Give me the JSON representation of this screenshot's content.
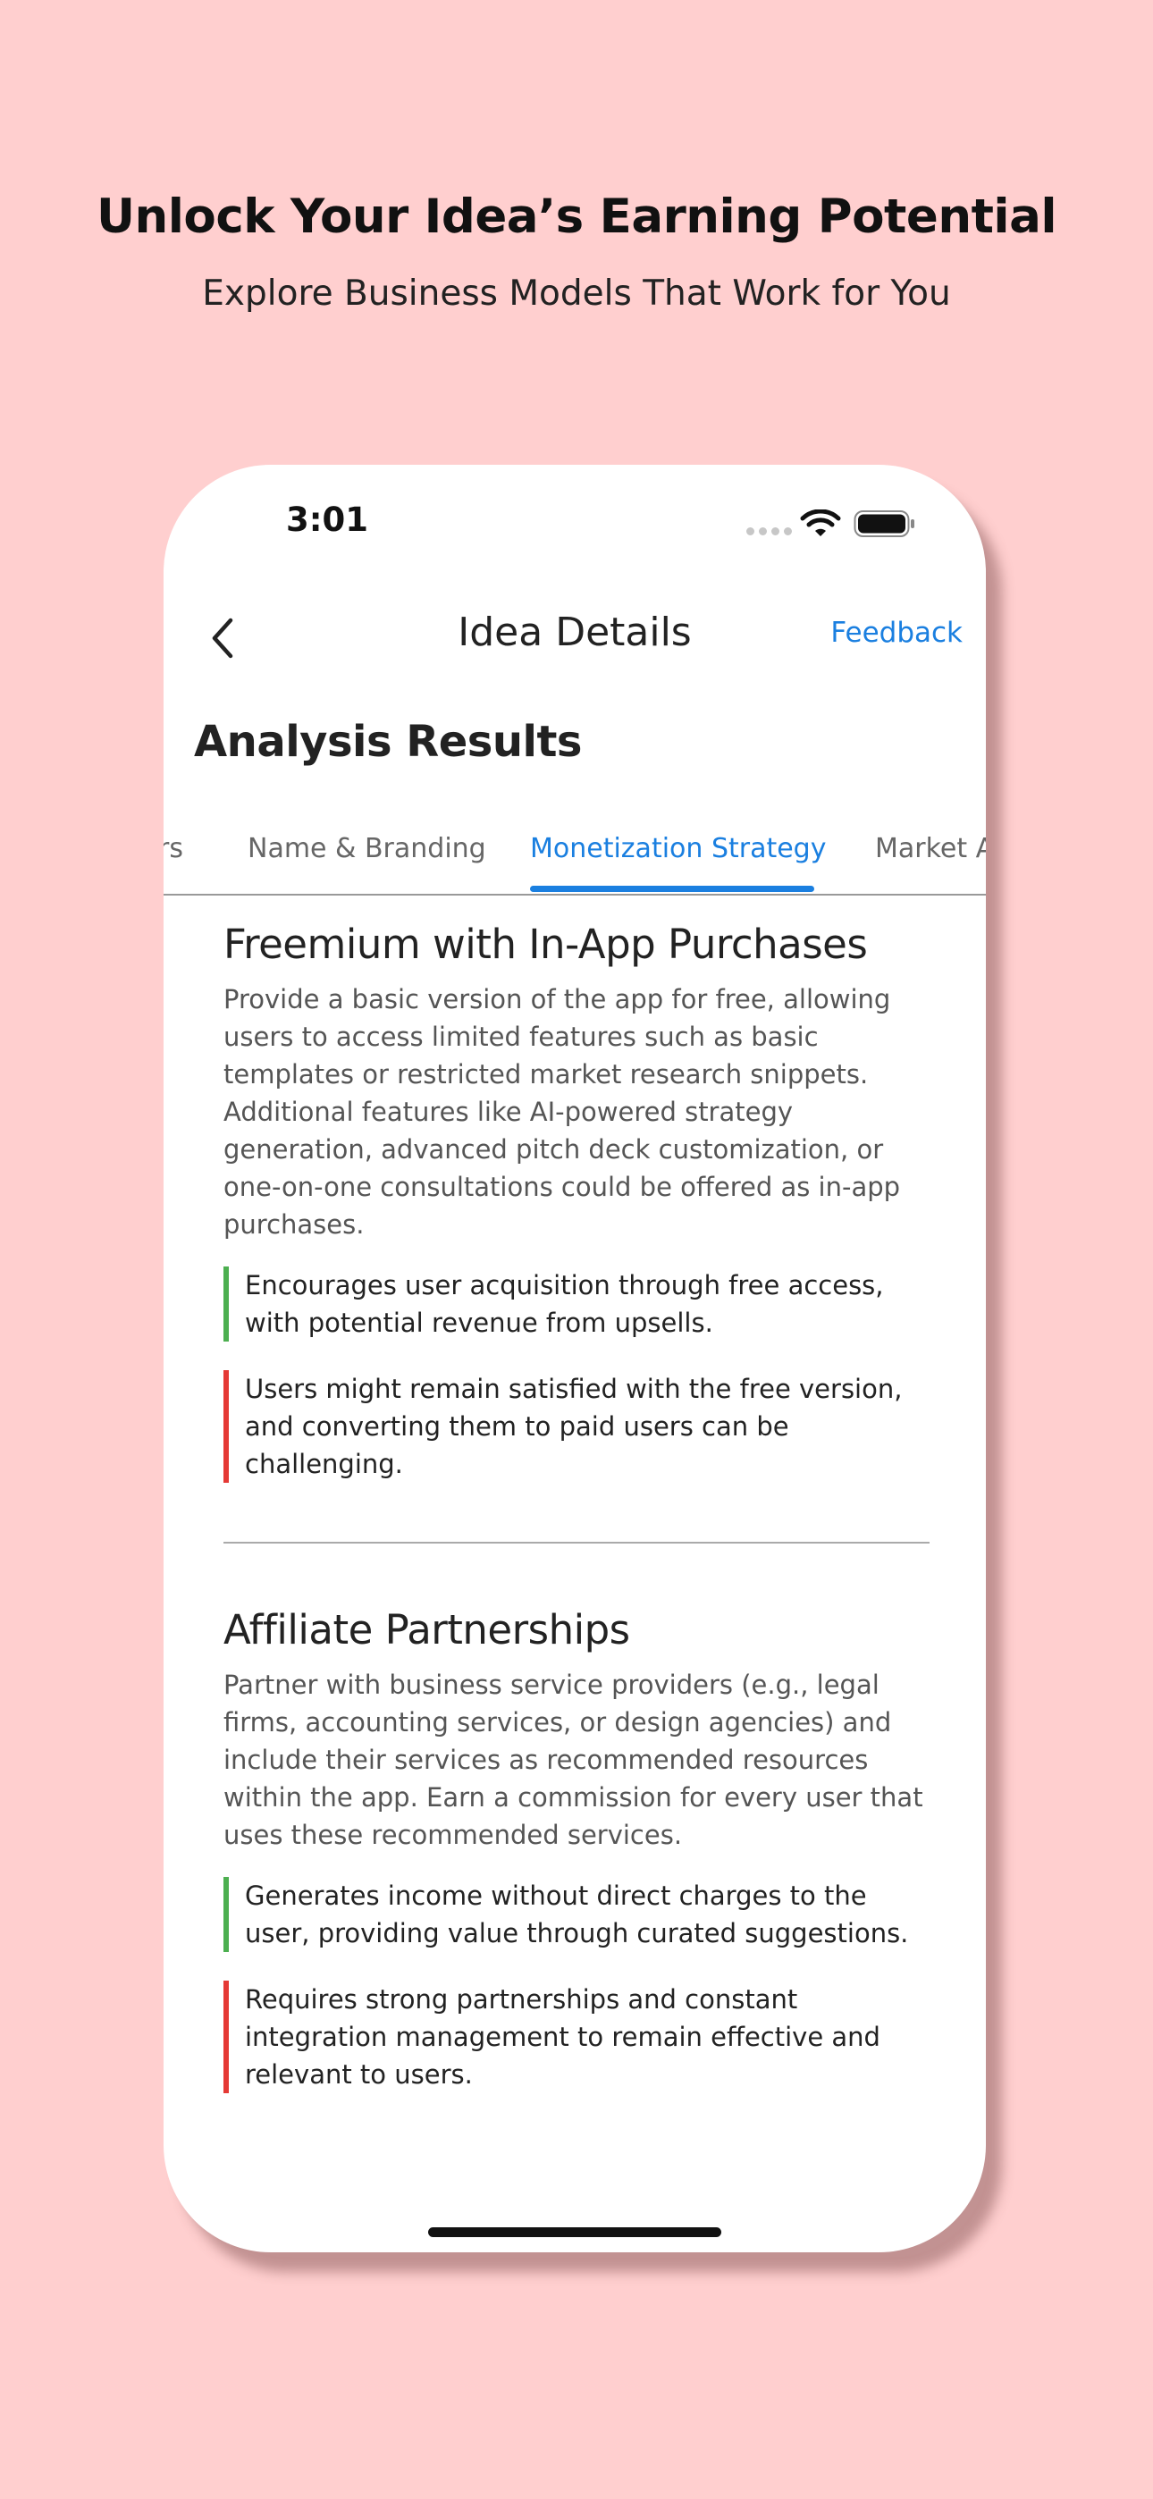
{
  "promo": {
    "title": "Unlock Your Idea’s Earning Potential",
    "subtitle": "Explore Business Models That Work for You"
  },
  "status_bar": {
    "time": "3:01",
    "icons": [
      "signal-dots-icon",
      "wifi-icon",
      "battery-icon"
    ]
  },
  "nav": {
    "back_icon": "chevron-left-icon",
    "title": "Idea Details",
    "feedback_label": "Feedback"
  },
  "page": {
    "section_title": "Analysis Results"
  },
  "tabs": {
    "items": [
      {
        "label": "rs"
      },
      {
        "label": "Name & Branding"
      },
      {
        "label": "Monetization Strategy",
        "active": true
      },
      {
        "label": "Market A"
      }
    ]
  },
  "strategies": [
    {
      "title": "Freemium with In-App Purchases",
      "description": "Provide a basic version of the app for free, allowing users to access limited features such as basic templates or restricted market research snippets. Additional features like AI-powered strategy generation, advanced pitch deck customization, or one-on-one consultations could be offered as in-app purchases.",
      "pro": "Encourages user acquisition through free access, with potential revenue from upsells.",
      "con": "Users might remain satisfied with the free version, and converting them to paid users can be challenging."
    },
    {
      "title": "Affiliate Partnerships",
      "description": "Partner with business service providers (e.g., legal firms, accounting services, or design agencies) and include their services as recommended resources within the app. Earn a commission for every user that uses these recommended services.",
      "pro": "Generates income without direct charges to the user, providing value through curated suggestions.",
      "con": "Requires strong partnerships and constant integration management to remain effective and relevant to users."
    }
  ],
  "colors": {
    "background": "#ffcfcf",
    "accent": "#1a7fe0",
    "pro_bar": "#4caf50",
    "con_bar": "#e53935"
  }
}
